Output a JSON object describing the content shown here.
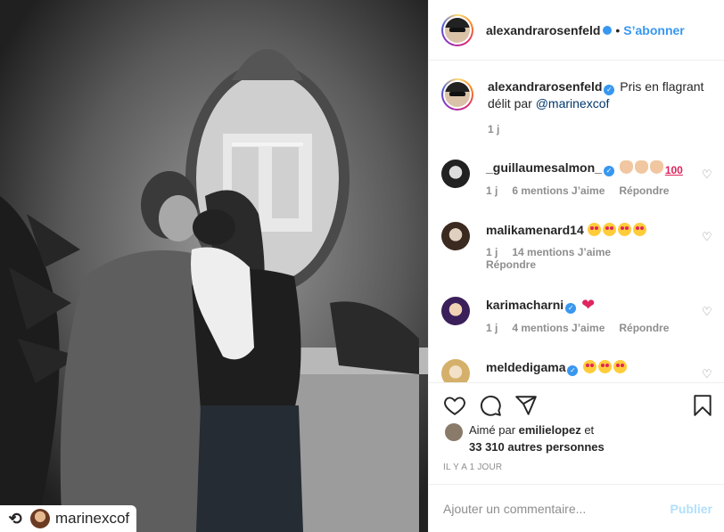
{
  "repost": {
    "username": "marinexcof"
  },
  "header": {
    "username": "alexandrarosenfeld",
    "separator": "•",
    "follow_label": "S’abonner"
  },
  "caption": {
    "username": "alexandrarosenfeld",
    "text": "Pris en flagrant délit par ",
    "mention": "@marinexcof",
    "time": "1 j"
  },
  "comments": [
    {
      "username": "_guillaumesalmon_",
      "verified": true,
      "time": "1 j",
      "likes": "6 mentions J’aime",
      "reply": "Répondre"
    },
    {
      "username": "malikamenard14",
      "verified": false,
      "time": "1 j",
      "likes": "14 mentions J’aime",
      "reply": "Répondre"
    },
    {
      "username": "karimacharni",
      "verified": true,
      "time": "1 j",
      "likes": "4 mentions J’aime",
      "reply": "Répondre"
    },
    {
      "username": "meldedigama",
      "verified": true
    }
  ],
  "likes": {
    "prefix": "Aimé par ",
    "first_user": "emilielopez",
    "suffix": " et",
    "others": "33 310 autres personnes"
  },
  "timestamp": "IL Y A 1 JOUR",
  "add_comment": {
    "placeholder": "Ajouter un commentaire...",
    "publish_label": "Publier"
  },
  "colors": {
    "accent": "#3897f0",
    "text": "#262626",
    "muted": "#8e8e8e",
    "publish_disabled": "#b2dffc"
  }
}
